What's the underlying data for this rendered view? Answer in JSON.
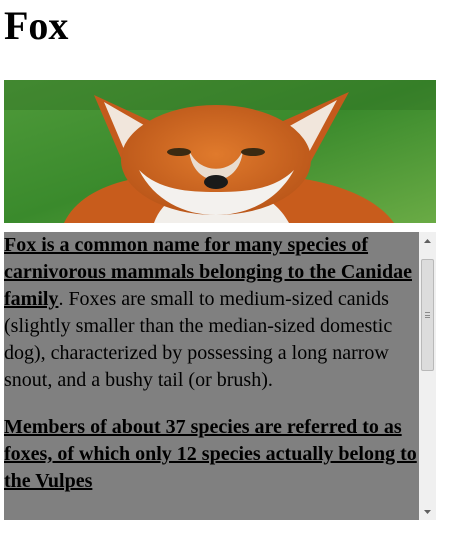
{
  "page": {
    "title": "Fox"
  },
  "hero_image": {
    "alt": "Red fox portrait",
    "colors": {
      "background_grass": "#3f8f2e",
      "fur_orange": "#d2651f",
      "fur_white": "#f3f1ee"
    }
  },
  "article": {
    "paragraph1": {
      "lead": "Fox is a common name for many species of carnivorous mammals belonging to the Canidae family",
      "text": ". Foxes are small to medium-sized canids (slightly smaller than the median-sized domestic dog), characterized by possessing a long narrow snout, and a bushy tail (or brush)."
    },
    "paragraph2": {
      "lead": "Members of about 37 species are referred to as foxes, of which only 12 species actually belong to the Vulpes"
    }
  },
  "scrollbar": {
    "up_icon": "arrow-up-icon",
    "down_icon": "arrow-down-icon",
    "position": 0.0
  }
}
